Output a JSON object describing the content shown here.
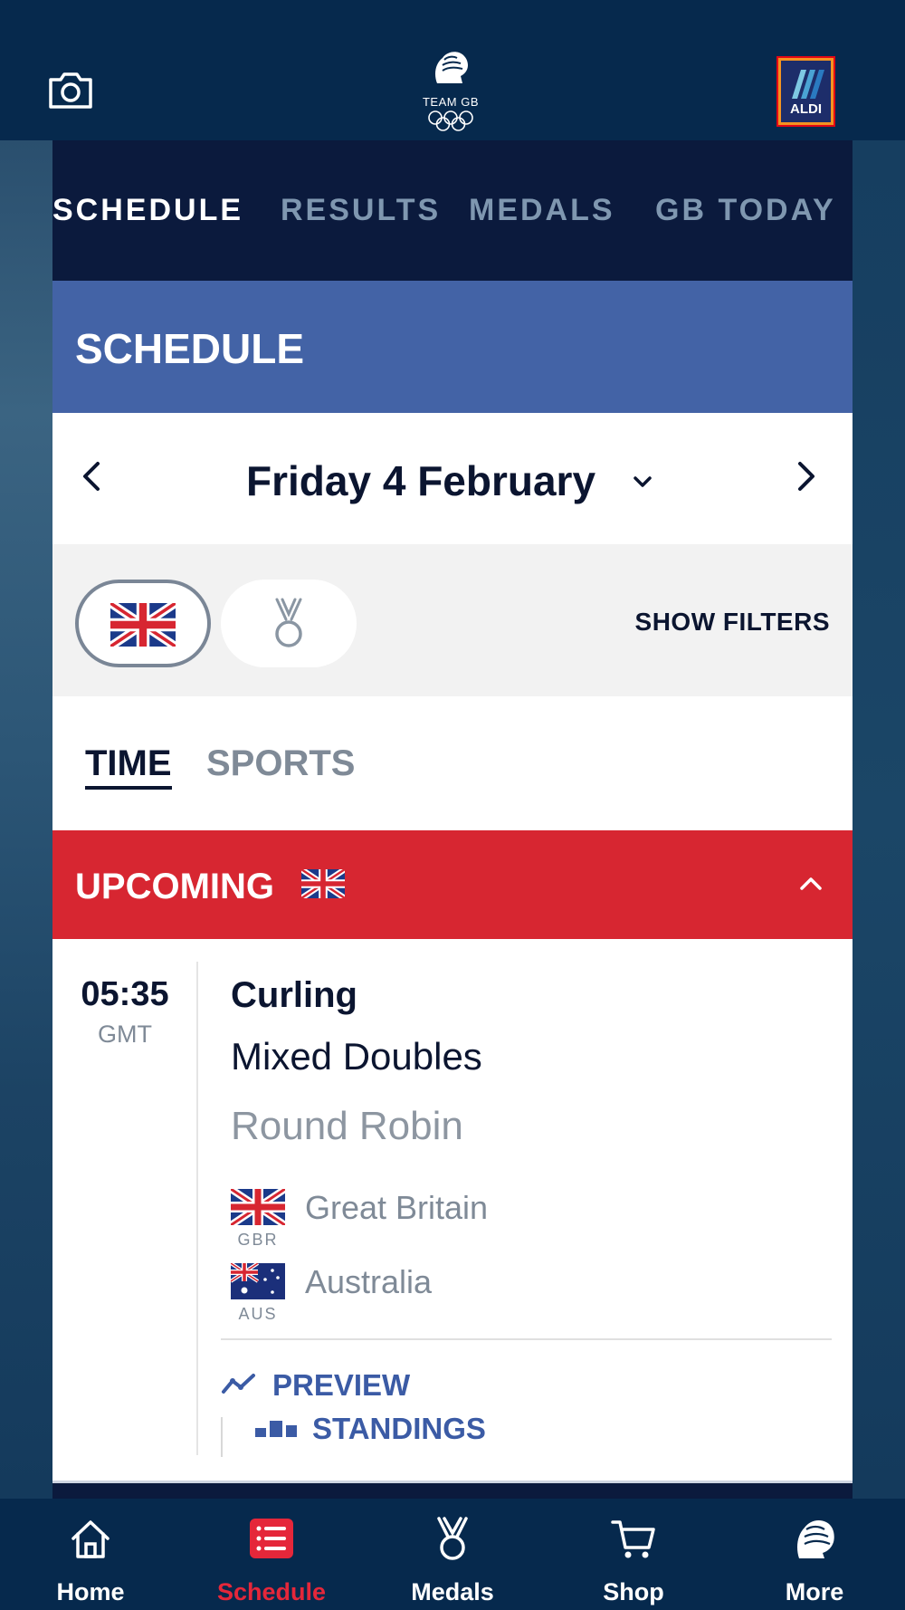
{
  "header": {
    "logo_text": "TEAM GB",
    "sponsor_label": "ALDI"
  },
  "subnav": {
    "items": [
      {
        "label": "SCHEDULE",
        "active": true
      },
      {
        "label": "RESULTS",
        "active": false
      },
      {
        "label": "MEDALS",
        "active": false
      },
      {
        "label": "GB TODAY",
        "active": false
      }
    ]
  },
  "schedule": {
    "title": "SCHEDULE",
    "date": "Friday 4 February",
    "show_filters": "SHOW FILTERS",
    "tabs": [
      {
        "label": "TIME",
        "active": true
      },
      {
        "label": "SPORTS",
        "active": false
      }
    ],
    "section_title": "UPCOMING",
    "event": {
      "time": "05:35",
      "timezone": "GMT",
      "sport": "Curling",
      "discipline": "Mixed Doubles",
      "phase": "Round Robin",
      "teams": [
        {
          "code": "GBR",
          "name": "Great Britain"
        },
        {
          "code": "AUS",
          "name": "Australia"
        }
      ],
      "links": {
        "preview": "PREVIEW",
        "standings": "STANDINGS"
      }
    }
  },
  "bottom_nav": {
    "items": [
      {
        "label": "Home",
        "icon": "home-icon",
        "active": false
      },
      {
        "label": "Schedule",
        "icon": "schedule-icon",
        "active": true
      },
      {
        "label": "Medals",
        "icon": "medal-icon",
        "active": false
      },
      {
        "label": "Shop",
        "icon": "cart-icon",
        "active": false
      },
      {
        "label": "More",
        "icon": "lion-icon",
        "active": false
      }
    ]
  },
  "colors": {
    "navy": "#06294d",
    "subnav_bg": "#0b1a3d",
    "schedule_blue": "#4363a6",
    "upcoming_red": "#d72631",
    "active_tab_red": "#e5273a",
    "link_blue": "#3b5ba5"
  }
}
